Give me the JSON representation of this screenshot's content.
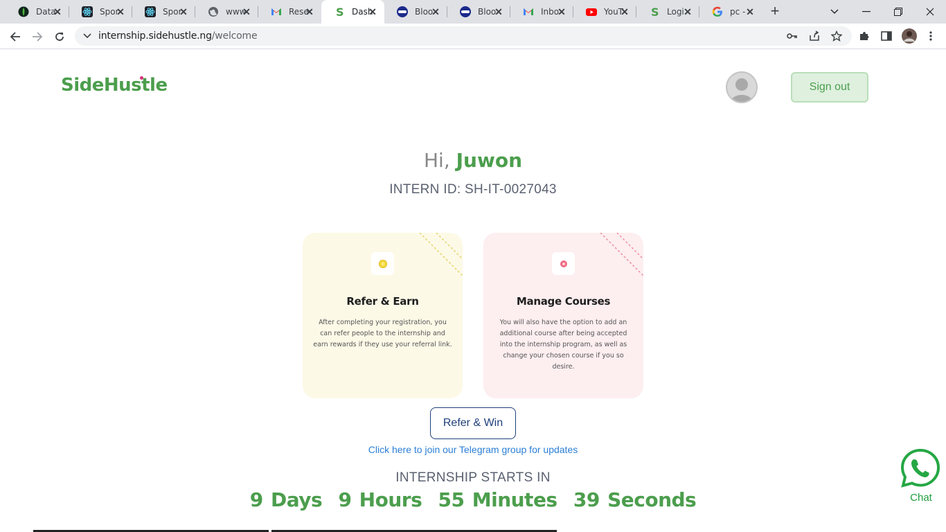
{
  "browser": {
    "tabs": [
      {
        "title": "Data",
        "icon": "mongodb-leaf-icon"
      },
      {
        "title": "Spor",
        "icon": "react-icon"
      },
      {
        "title": "Spor",
        "icon": "react-icon"
      },
      {
        "title": "www",
        "icon": "globe-icon"
      },
      {
        "title": "Rese",
        "icon": "gmail-icon"
      },
      {
        "title": "Dash",
        "icon": "sidehustle-icon",
        "active": true
      },
      {
        "title": "Bloo",
        "icon": "bloom-icon"
      },
      {
        "title": "Bloo",
        "icon": "bloom-icon"
      },
      {
        "title": "Inbo",
        "icon": "gmail-icon"
      },
      {
        "title": "YouT",
        "icon": "youtube-icon"
      },
      {
        "title": "Logi",
        "icon": "sidehustle-icon"
      },
      {
        "title": "pc - ",
        "icon": "google-icon"
      }
    ],
    "url_host": "internship.sidehustle.ng",
    "url_path": "/welcome"
  },
  "header": {
    "logo_text": "SideHustle",
    "signout_label": "Sign out"
  },
  "greeting": {
    "prefix": "Hi,",
    "name": "Juwon",
    "intern_id": "INTERN ID: SH-IT-0027043"
  },
  "cards": [
    {
      "title": "Refer & Earn",
      "description": "After completing your registration, you can refer people to the internship and earn rewards if they use your referral link."
    },
    {
      "title": "Manage Courses",
      "description": "You will also have the option to add an additional course after being accepted into the internship program, as well as change your chosen course if you so desire."
    }
  ],
  "refer_button": "Refer & Win",
  "telegram_link": "Click here to join our Telegram group for updates",
  "countdown": {
    "label": "INTERNSHIP STARTS IN",
    "days": "9 Days",
    "hours": "9 Hours",
    "minutes": "55 Minutes",
    "seconds": "39 Seconds"
  },
  "chat": {
    "label": "Chat"
  },
  "colors": {
    "brand_green": "#4c9e4d",
    "link_blue": "#2b7fd6",
    "navy": "#1e3f7a",
    "card_yellow": "#fcf9e7",
    "card_pink": "#fdeef0"
  }
}
